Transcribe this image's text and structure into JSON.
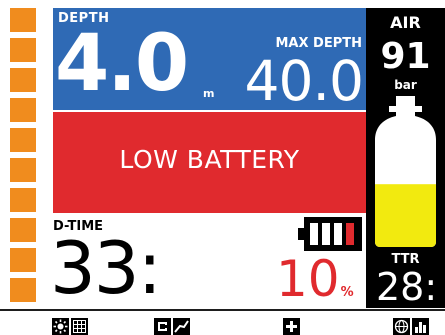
{
  "depth": {
    "label": "DEPTH",
    "value": "4.0",
    "unit": "m"
  },
  "max_depth": {
    "label": "MAX DEPTH",
    "value": "40.0"
  },
  "warning": {
    "text": "LOW BATTERY"
  },
  "air": {
    "label": "AIR",
    "value": "91",
    "unit": "bar",
    "tank_fill_fraction": 0.42
  },
  "ttr": {
    "label": "TTR",
    "value": "28:"
  },
  "dive_time": {
    "label": "D-TIME",
    "value": "33:"
  },
  "battery": {
    "value": "10",
    "unit": "%",
    "bars_filled": 1,
    "bars_total": 4
  },
  "ascent_ladder": {
    "segments": 10
  },
  "softkeys": [
    {
      "name": "light-grid",
      "icons": [
        "brightness-icon",
        "grid-icon"
      ]
    },
    {
      "name": "compass-graph",
      "icons": [
        "compass-icon",
        "profile-graph-icon"
      ]
    },
    {
      "name": "plus",
      "icons": [
        "plus-icon"
      ]
    },
    {
      "name": "globe-bars",
      "icons": [
        "globe-icon",
        "bar-graph-icon"
      ]
    }
  ],
  "colors": {
    "depth_panel": "#2f6ab5",
    "warning_panel": "#e02a2e",
    "ladder": "#f08c1e",
    "tank_gas": "#f2ea0f",
    "battery_low": "#e02a2e"
  }
}
